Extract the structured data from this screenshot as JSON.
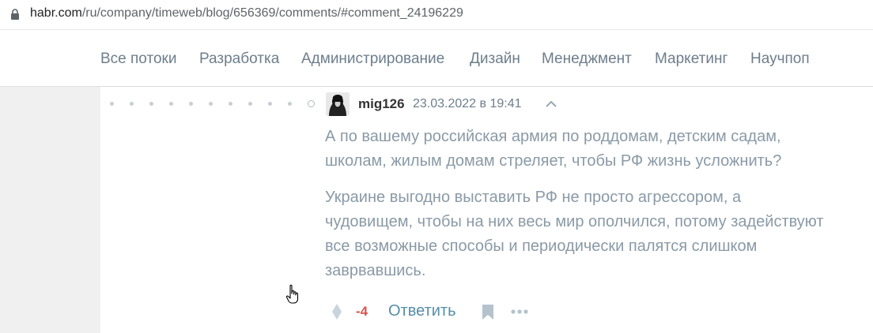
{
  "browser": {
    "url_host": "habr.com",
    "url_path": "/ru/company/timeweb/blog/656369/comments/#comment_24196229"
  },
  "nav": {
    "items": [
      {
        "label": "Все потоки"
      },
      {
        "label": "Разработка"
      },
      {
        "label": "Администрирование"
      },
      {
        "label": "Дизайн"
      },
      {
        "label": "Менеджмент"
      },
      {
        "label": "Маркетинг"
      },
      {
        "label": "Научпоп"
      }
    ]
  },
  "comment": {
    "username": "mig126",
    "datetime": "23.03.2022 в 19:41",
    "lines": [
      "А по вашему российская армия по роддомам, детским садам,",
      "школам, жилым домам стреляет, чтобы РФ жизнь усложнить?",
      "Украине выгодно выставить РФ не просто агрессором, а",
      "чудовищем, чтобы на них весь мир ополчился, потому задействуют",
      "все возможные способы и периодически палятся слишком",
      "заврвавшись."
    ],
    "score": "-4",
    "reply_label": "Ответить"
  },
  "colors": {
    "nav_text": "#6d7e8c",
    "comment_text": "#8a9aa6",
    "score_negative": "#d9534f",
    "reply_link": "#548eaa"
  }
}
